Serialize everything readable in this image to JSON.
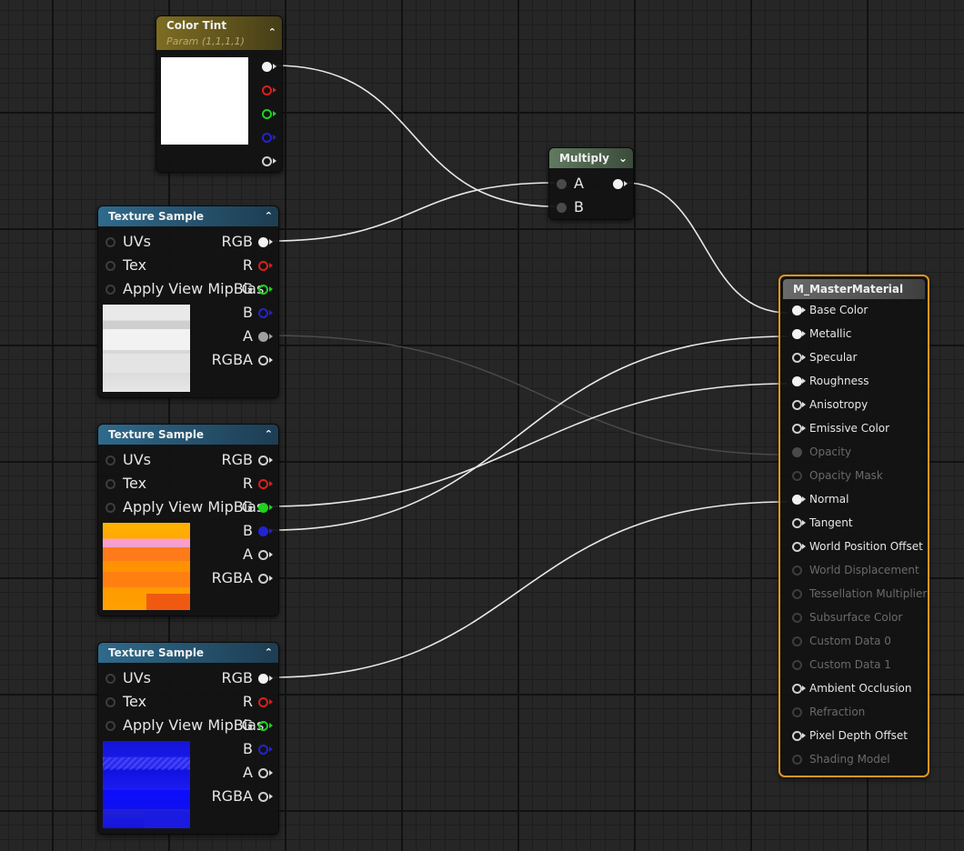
{
  "colors": {
    "wire": "#e8e8e8",
    "wire_faint": "#4c4c4c",
    "pin_red": "#dd1e1e",
    "pin_green": "#1ed21e",
    "pin_blue": "#2323d2",
    "selection": "#e6961e"
  },
  "color_tint": {
    "title": "Color Tint",
    "subtitle": "Param (1,1,1,1)",
    "collapse_icon": "chevron-up-icon"
  },
  "texture_samples": [
    {
      "title": "Texture Sample",
      "inputs": [
        "UVs",
        "Tex",
        "Apply View MipBias"
      ],
      "outputs": [
        "RGB",
        "R",
        "G",
        "B",
        "A",
        "RGBA"
      ],
      "preview": "white-grey"
    },
    {
      "title": "Texture Sample",
      "inputs": [
        "UVs",
        "Tex",
        "Apply View MipBias"
      ],
      "outputs": [
        "RGB",
        "R",
        "G",
        "B",
        "A",
        "RGBA"
      ],
      "preview": "orange"
    },
    {
      "title": "Texture Sample",
      "inputs": [
        "UVs",
        "Tex",
        "Apply View MipBias"
      ],
      "outputs": [
        "RGB",
        "R",
        "G",
        "B",
        "A",
        "RGBA"
      ],
      "preview": "blue-normal"
    }
  ],
  "multiply": {
    "title": "Multiply",
    "inputs": [
      "A",
      "B"
    ],
    "collapse_icon": "chevron-down-icon"
  },
  "master": {
    "title": "M_MasterMaterial",
    "pins": [
      {
        "label": "Base Color",
        "state": "connected"
      },
      {
        "label": "Metallic",
        "state": "connected"
      },
      {
        "label": "Specular",
        "state": "open"
      },
      {
        "label": "Roughness",
        "state": "connected"
      },
      {
        "label": "Anisotropy",
        "state": "open"
      },
      {
        "label": "Emissive Color",
        "state": "open"
      },
      {
        "label": "Opacity",
        "state": "disabled-connected"
      },
      {
        "label": "Opacity Mask",
        "state": "disabled"
      },
      {
        "label": "Normal",
        "state": "connected"
      },
      {
        "label": "Tangent",
        "state": "open"
      },
      {
        "label": "World Position Offset",
        "state": "open"
      },
      {
        "label": "World Displacement",
        "state": "disabled"
      },
      {
        "label": "Tessellation Multiplier",
        "state": "disabled"
      },
      {
        "label": "Subsurface Color",
        "state": "disabled"
      },
      {
        "label": "Custom Data 0",
        "state": "disabled"
      },
      {
        "label": "Custom Data 1",
        "state": "disabled"
      },
      {
        "label": "Ambient Occlusion",
        "state": "open"
      },
      {
        "label": "Refraction",
        "state": "disabled"
      },
      {
        "label": "Pixel Depth Offset",
        "state": "open"
      },
      {
        "label": "Shading Model",
        "state": "disabled"
      }
    ]
  }
}
